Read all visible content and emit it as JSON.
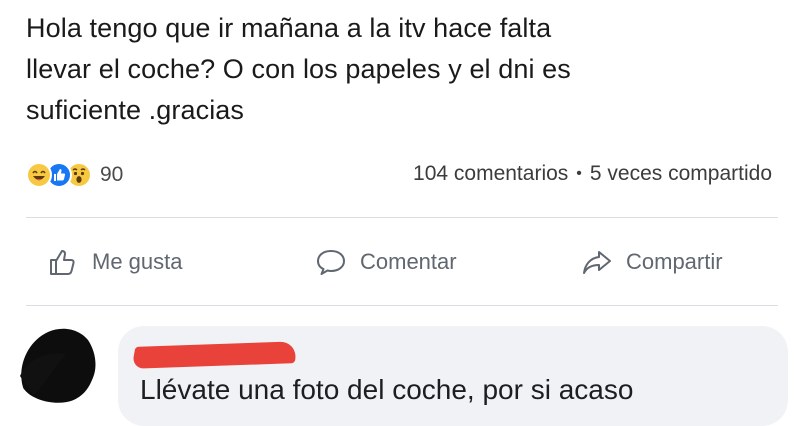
{
  "post": {
    "text": "Hola tengo que ir mañana  a la  itv hace falta\nllevar el coche? O con los papeles y el dni es\nsuficiente .gracias"
  },
  "stats": {
    "reactions": [
      "haha-icon",
      "like-icon",
      "wow-icon"
    ],
    "reaction_count": "90",
    "comments": "104 comentarios",
    "separator": "•",
    "shares": "5 veces compartido"
  },
  "actions": {
    "like_label": "Me gusta",
    "comment_label": "Comentar",
    "share_label": "Compartir"
  },
  "comment": {
    "text": "Llévate una foto del coche, por si acaso"
  },
  "colors": {
    "like_blue": "#1877f2",
    "reaction_yellow": "#f7c842",
    "redaction_red": "#e8382f",
    "bubble_gray": "#f0f2f5"
  }
}
